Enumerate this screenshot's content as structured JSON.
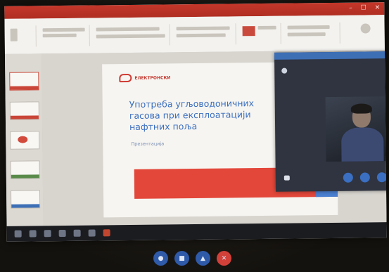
{
  "window": {
    "title": "",
    "user": ""
  },
  "ribbon": {
    "tabs": []
  },
  "slide": {
    "logo_text": "ЕЛЕКТРОНСКИ",
    "title": "Употреба угљоводоничних гасова при експлоатацији нафтних поља",
    "subtitle": "Презентација",
    "band_text": ""
  },
  "call": {
    "caller": "",
    "status": "",
    "video_label": ""
  },
  "taskbar": {
    "tray_time": ""
  },
  "colors": {
    "accent_red": "#c3372a",
    "call_blue": "#3d6fb5",
    "end_call": "#d2403a"
  },
  "icons": {
    "mic": "microphone-icon",
    "video": "video-camera-icon",
    "screen": "screen-share-icon",
    "end": "end-call-icon"
  }
}
